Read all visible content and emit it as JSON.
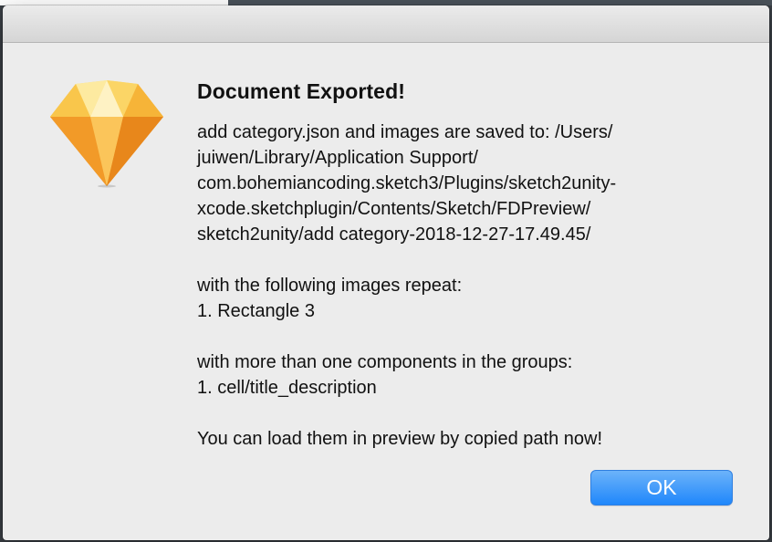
{
  "dialog": {
    "icon": "sketch-diamond-icon",
    "title": "Document Exported!",
    "message": "add category.json and images are saved to: /Users/\njuiwen/Library/Application Support/\ncom.bohemiancoding.sketch3/Plugins/sketch2unity-\nxcode.sketchplugin/Contents/Sketch/FDPreview/\nsketch2unity/add category-2018-12-27-17.49.45/\n\nwith the following images repeat:\n1. Rectangle 3\n\nwith more than one components in the groups:\n1. cell/title_description\n\nYou can load them in preview by copied path now!",
    "ok_label": "OK"
  },
  "colors": {
    "dialog_bg": "#ececec",
    "button_blue": "#1f87fb",
    "icon_orange": "#f7a23a"
  }
}
